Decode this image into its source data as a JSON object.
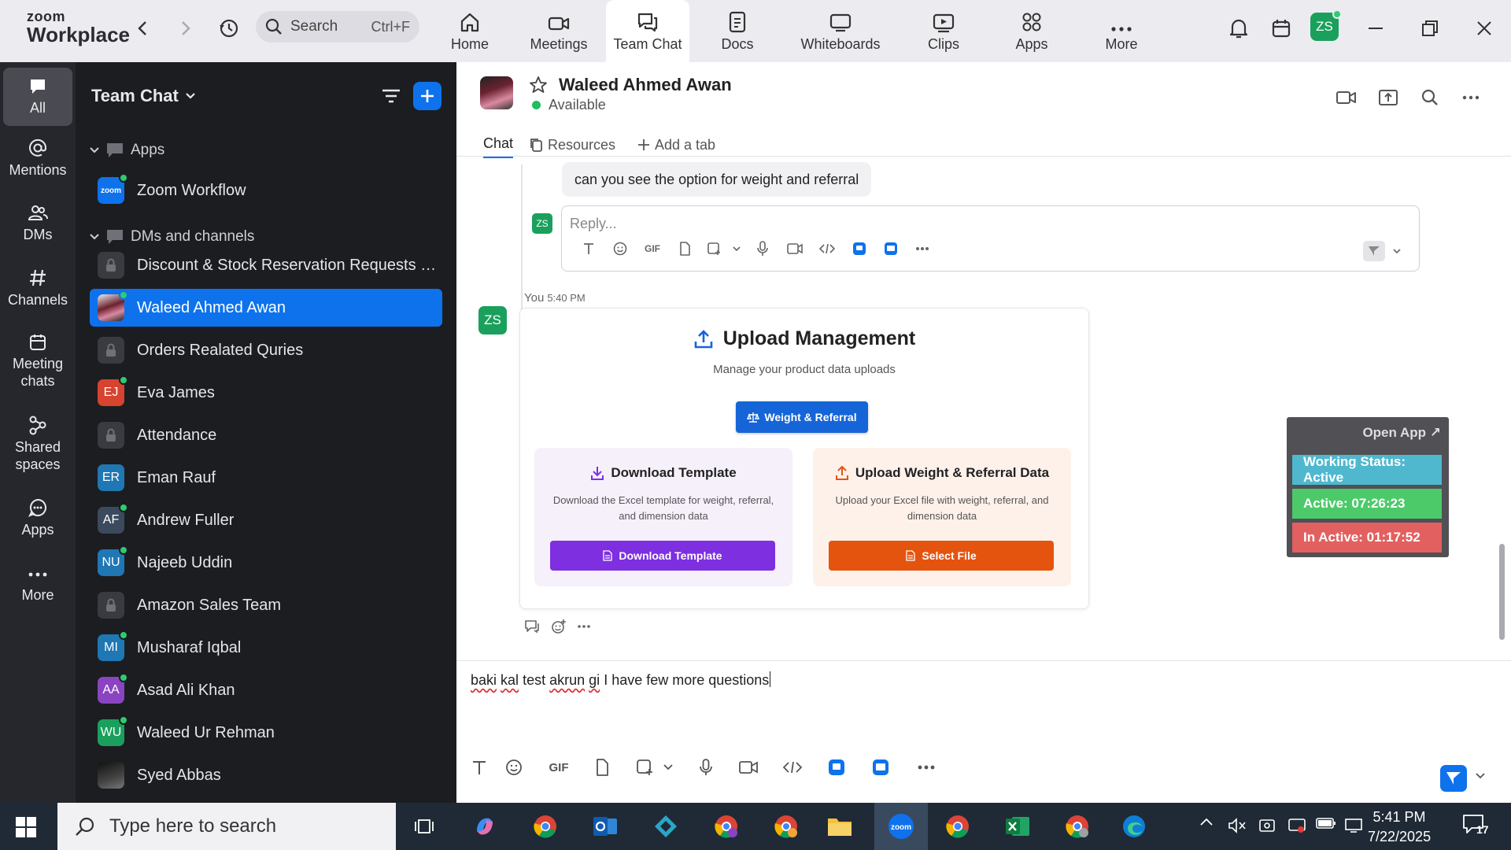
{
  "app": {
    "logo_line1": "zoom",
    "logo_line2": "Workplace",
    "search_label": "Search",
    "search_shortcut": "Ctrl+F",
    "avatar_initials": "ZS",
    "accent": "#0e72ed"
  },
  "tabs": [
    {
      "label": "Home",
      "icon": "home-icon"
    },
    {
      "label": "Meetings",
      "icon": "video-camera-icon"
    },
    {
      "label": "Team Chat",
      "icon": "chat-icon",
      "active": true
    },
    {
      "label": "Docs",
      "icon": "document-icon"
    },
    {
      "label": "Whiteboards",
      "icon": "whiteboard-icon"
    },
    {
      "label": "Clips",
      "icon": "clips-icon"
    },
    {
      "label": "Apps",
      "icon": "apps-icon"
    },
    {
      "label": "More",
      "icon": "more-icon"
    }
  ],
  "rail": [
    {
      "label": "All",
      "icon": "chat-bubble-icon",
      "active": true
    },
    {
      "label": "Mentions",
      "icon": "at-icon"
    },
    {
      "label": "DMs",
      "icon": "people-icon"
    },
    {
      "label": "Channels",
      "icon": "hash-icon"
    },
    {
      "label": "Meeting chats",
      "icon": "calendar-icon"
    },
    {
      "label": "Shared spaces",
      "icon": "shared-spaces-icon"
    },
    {
      "label": "Apps",
      "icon": "apps-bubble-icon"
    },
    {
      "label": "More",
      "icon": "ellipsis-icon"
    }
  ],
  "sidebar": {
    "title": "Team Chat",
    "section_apps": "Apps",
    "app_item": {
      "label": "Zoom Workflow",
      "badge": "zoom"
    },
    "section_dms": "DMs and channels",
    "items": [
      {
        "label": "Discount & Stock Reservation Requests O...",
        "type": "lock"
      },
      {
        "label": "Waleed Ahmed Awan",
        "type": "photo",
        "selected": true,
        "online": true
      },
      {
        "label": "Orders Realated Quries",
        "type": "lock"
      },
      {
        "label": "Eva James",
        "type": "initials",
        "initials": "EJ",
        "color": "#d6432f",
        "online": true
      },
      {
        "label": "Attendance",
        "type": "lock"
      },
      {
        "label": "Eman Rauf",
        "type": "initials",
        "initials": "ER",
        "color": "#1f77b4"
      },
      {
        "label": "Andrew Fuller",
        "type": "initials",
        "initials": "AF",
        "color": "#3b4a5c",
        "online": true
      },
      {
        "label": "Najeeb Uddin",
        "type": "initials",
        "initials": "NU",
        "color": "#1f77b4",
        "online": true
      },
      {
        "label": "Amazon Sales Team",
        "type": "lock"
      },
      {
        "label": "Musharaf Iqbal",
        "type": "initials",
        "initials": "MI",
        "color": "#1f77b4",
        "online": true
      },
      {
        "label": "Asad Ali Khan",
        "type": "initials",
        "initials": "AA",
        "color": "#8a44c2",
        "online": true
      },
      {
        "label": "Waleed Ur Rehman",
        "type": "initials",
        "initials": "WU",
        "color": "#1aa05c",
        "online": true
      },
      {
        "label": "Syed Abbas",
        "type": "photo-dark"
      }
    ]
  },
  "chat": {
    "contact_name": "Waleed Ahmed Awan",
    "status": "Available",
    "tabs": {
      "chat": "Chat",
      "resources": "Resources",
      "add": "Add a tab"
    },
    "prev_message": "can you see the option for weight and referral",
    "reply_avatar": "ZS",
    "reply_placeholder": "Reply...",
    "gif_label": "GIF",
    "message": {
      "sender": "You",
      "time": "5:40 PM",
      "avatar": "ZS"
    },
    "card": {
      "title": "Upload Management",
      "subtitle": "Manage your product data uploads",
      "weight_button": "Weight & Referral",
      "download": {
        "title": "Download Template",
        "desc": "Download the Excel template for weight, referral, and dimension data",
        "button": "Download Template",
        "button_color": "#7e2fe0"
      },
      "upload": {
        "title": "Upload Weight & Referral Data",
        "desc": "Upload your Excel file with weight, referral, and dimension data",
        "button": "Select File",
        "button_color": "#e5540f"
      }
    },
    "compose": {
      "w1": "baki",
      "w2": "kal",
      "w3": "test",
      "w4": "akrun",
      "w5": "gi",
      "rest": "I have few more questions"
    }
  },
  "widget": {
    "open_app": "Open App ↗",
    "working_status": "Working Status: Active",
    "active": "Active: 07:26:23",
    "inactive": "In Active: 01:17:52",
    "colors": {
      "status": "#4fb8cf",
      "active": "#4cca6a",
      "inactive": "#e2605f"
    }
  },
  "taskbar": {
    "search_placeholder": "Type here to search",
    "time": "5:41 PM",
    "date": "7/22/2025",
    "notification_count": "17"
  }
}
